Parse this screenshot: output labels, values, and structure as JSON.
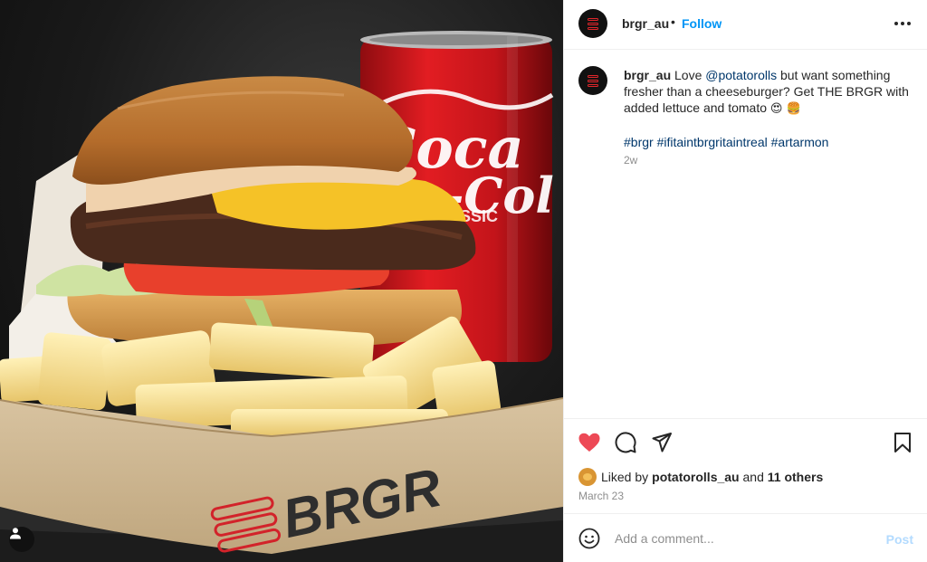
{
  "colors": {
    "accent": "#0095f6",
    "like_red": "#ed4956",
    "muted": "#8e8e8e",
    "link": "#00376b",
    "post_disabled": "#b3dbff",
    "brand_red": "#e0262b"
  },
  "photo": {
    "can_text": "Coca-Cola",
    "can_sub": "SSIC",
    "box_logo": "BRGR",
    "tag_icon": "person-tag-icon"
  },
  "header": {
    "username": "brgr_au",
    "separator": "•",
    "follow_label": "Follow",
    "more_icon": "more-options-icon"
  },
  "caption": {
    "username": "brgr_au",
    "text_before": " Love ",
    "mention": "@potatorolls",
    "text_after": " but want something fresher than a cheeseburger? Get THE BRGR with added lettuce and tomato ",
    "emojis": "😍 🍔",
    "hashtags": "#brgr #ifitaintbrgritaintreal #artarmon",
    "time_ago": "2w"
  },
  "actions": {
    "like_icon": "heart-filled-icon",
    "comment_icon": "comment-icon",
    "share_icon": "share-icon",
    "save_icon": "bookmark-icon",
    "liked": true
  },
  "likes": {
    "prefix": "Liked by ",
    "user": "potatorolls_au",
    "middle": " and ",
    "others": "11 others"
  },
  "date": "March 23",
  "comment": {
    "placeholder": "Add a comment...",
    "post_label": "Post",
    "emoji_icon": "emoji-icon"
  }
}
